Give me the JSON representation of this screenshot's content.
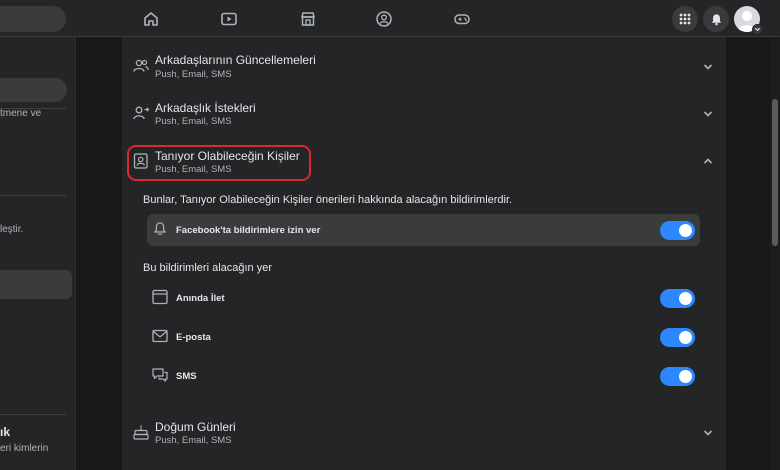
{
  "topbar": {
    "nav_icons": [
      "home-icon",
      "video-icon",
      "marketplace-icon",
      "groups-icon",
      "gaming-icon"
    ],
    "right_icons": [
      "menu-grid-icon",
      "notifications-bell-icon",
      "profile-avatar"
    ]
  },
  "sidebar": {
    "text_1": "tmene ve",
    "text_2": "leştir.",
    "bold_heading": "ık",
    "text_3": "eri kimlerin"
  },
  "settings": {
    "rows": [
      {
        "title": "Arkadaşlarının Güncellemeleri",
        "subtitle": "Push, Email, SMS",
        "icon": "friends-icon",
        "expanded": false
      },
      {
        "title": "Arkadaşlık İstekleri",
        "subtitle": "Push, Email, SMS",
        "icon": "friend-request-icon",
        "expanded": false
      },
      {
        "title": "Tanıyor Olabileceğin Kişiler",
        "subtitle": "Push, Email, SMS",
        "icon": "contact-card-icon",
        "expanded": true
      },
      {
        "title": "Doğum Günleri",
        "subtitle": "Push, Email, SMS",
        "icon": "birthday-cake-icon",
        "expanded": false
      }
    ],
    "expanded_section": {
      "description": "Bunlar, Tanıyor Olabileceğin Kişiler önerileri hakkında alacağın bildirimlerdir.",
      "permission": {
        "label": "Facebook'ta bildirimlere izin ver",
        "icon": "bell-icon",
        "enabled": true
      },
      "channels_heading": "Bu bildirimleri alacağın yer",
      "channels": [
        {
          "label": "Anında İlet",
          "icon": "browser-window-icon",
          "enabled": true
        },
        {
          "label": "E-posta",
          "icon": "envelope-icon",
          "enabled": true
        },
        {
          "label": "SMS",
          "icon": "chat-bubbles-icon",
          "enabled": true
        }
      ]
    }
  },
  "colors": {
    "toggle_on": "#2d88ff",
    "highlight": "#e0262e",
    "panel_bg": "#242526",
    "page_bg": "#18191a"
  }
}
